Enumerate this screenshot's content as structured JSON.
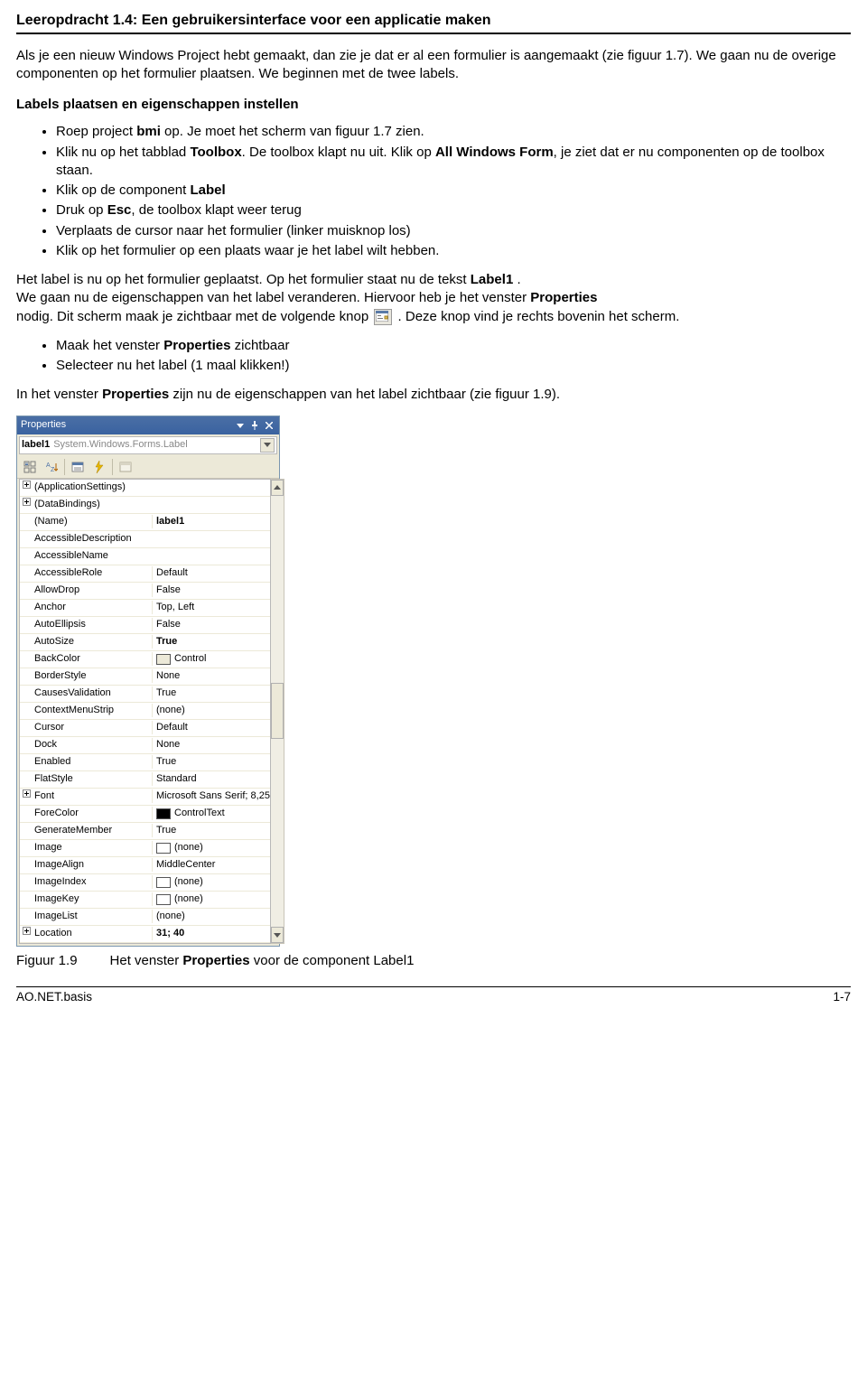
{
  "header": {
    "title": "Leeropdracht 1.4: Een gebruikersinterface voor een applicatie maken"
  },
  "intro": {
    "t1": "Als je een nieuw Windows Project hebt gemaakt, dan zie je dat er al een formulier is aangemaakt (zie figuur 1.7). We gaan nu de overige componenten op het formulier plaatsen. We beginnen met de twee labels."
  },
  "section1": {
    "title": "Labels plaatsen en eigenschappen instellen",
    "b1a": "Roep project ",
    "b1b": "bmi",
    "b1c": " op. Je moet het scherm van figuur 1.7 zien.",
    "b2a": "Klik nu op het tabblad ",
    "b2b": "Toolbox",
    "b2c": ". De toolbox klapt nu uit. Klik op ",
    "b2d": "All Windows Form",
    "b2e": ", je ziet dat er nu componenten op de toolbox staan.",
    "b3a": "Klik op de component ",
    "b3b": "Label",
    "b4a": "Druk op ",
    "b4b": "Esc",
    "b4c": ", de toolbox klapt weer terug",
    "b5": "Verplaats de cursor naar het formulier (linker muisknop los)",
    "b6": "Klik op het formulier op een plaats waar je het label wilt hebben."
  },
  "post1": {
    "p1a": "Het label is nu op het formulier geplaatst. Op het formulier staat nu de tekst ",
    "p1b": "Label1",
    "p1c": " .",
    "p2a": "We gaan nu de eigenschappen van het label veranderen. Hiervoor heb je het venster ",
    "p2b": "Properties",
    "p3a": "nodig. Dit scherm maak je zichtbaar met de volgende knop ",
    "p3b": " . Deze knop vind je rechts bovenin het scherm.",
    "b7a": "Maak het venster ",
    "b7b": "Properties",
    "b7c": "  zichtbaar",
    "b8": "Selecteer nu het label (1 maal klikken!)",
    "p4a": "In het venster ",
    "p4b": "Properties",
    "p4c": " zijn nu de eigenschappen van het label zichtbaar (zie figuur 1.9)."
  },
  "props": {
    "title": "Properties",
    "obj_name": "label1",
    "obj_type": "System.Windows.Forms.Label",
    "rows": [
      {
        "exp": "+",
        "k": "(ApplicationSettings)",
        "v": "",
        "bold": false
      },
      {
        "exp": "+",
        "k": "(DataBindings)",
        "v": "",
        "bold": false
      },
      {
        "exp": "",
        "k": "(Name)",
        "v": "label1",
        "bold": true
      },
      {
        "exp": "",
        "k": "AccessibleDescription",
        "v": "",
        "bold": false
      },
      {
        "exp": "",
        "k": "AccessibleName",
        "v": "",
        "bold": false
      },
      {
        "exp": "",
        "k": "AccessibleRole",
        "v": "Default",
        "bold": false
      },
      {
        "exp": "",
        "k": "AllowDrop",
        "v": "False",
        "bold": false
      },
      {
        "exp": "",
        "k": "Anchor",
        "v": "Top, Left",
        "bold": false
      },
      {
        "exp": "",
        "k": "AutoEllipsis",
        "v": "False",
        "bold": false
      },
      {
        "exp": "",
        "k": "AutoSize",
        "v": "True",
        "bold": true
      },
      {
        "exp": "",
        "k": "BackColor",
        "v": "Control",
        "bold": false,
        "swatch": "control"
      },
      {
        "exp": "",
        "k": "BorderStyle",
        "v": "None",
        "bold": false
      },
      {
        "exp": "",
        "k": "CausesValidation",
        "v": "True",
        "bold": false
      },
      {
        "exp": "",
        "k": "ContextMenuStrip",
        "v": "(none)",
        "bold": false
      },
      {
        "exp": "",
        "k": "Cursor",
        "v": "Default",
        "bold": false
      },
      {
        "exp": "",
        "k": "Dock",
        "v": "None",
        "bold": false
      },
      {
        "exp": "",
        "k": "Enabled",
        "v": "True",
        "bold": false
      },
      {
        "exp": "",
        "k": "FlatStyle",
        "v": "Standard",
        "bold": false
      },
      {
        "exp": "+",
        "k": "Font",
        "v": "Microsoft Sans Serif; 8,25",
        "bold": false
      },
      {
        "exp": "",
        "k": "ForeColor",
        "v": "ControlText",
        "bold": false,
        "swatch": "black"
      },
      {
        "exp": "",
        "k": "GenerateMember",
        "v": "True",
        "bold": false
      },
      {
        "exp": "",
        "k": "Image",
        "v": "(none)",
        "bold": false,
        "swatch": "none"
      },
      {
        "exp": "",
        "k": "ImageAlign",
        "v": "MiddleCenter",
        "bold": false
      },
      {
        "exp": "",
        "k": "ImageIndex",
        "v": "(none)",
        "bold": false,
        "swatch": "none"
      },
      {
        "exp": "",
        "k": "ImageKey",
        "v": "(none)",
        "bold": false,
        "swatch": "none"
      },
      {
        "exp": "",
        "k": "ImageList",
        "v": "(none)",
        "bold": false
      },
      {
        "exp": "+",
        "k": "Location",
        "v": "31; 40",
        "bold": true
      }
    ]
  },
  "figure": {
    "num": "Figuur 1.9",
    "cap1": "Het venster ",
    "cap2": "Properties",
    "cap3": " voor de component Label1"
  },
  "footer": {
    "left": "AO.NET.basis",
    "right": "1-7"
  }
}
